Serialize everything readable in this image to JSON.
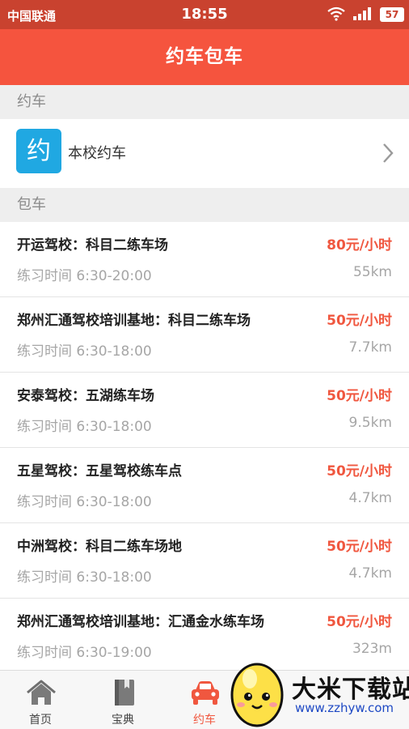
{
  "status_bar": {
    "carrier": "中国联通",
    "time": "18:55",
    "battery": "57"
  },
  "header": {
    "title": "约车包车"
  },
  "section_booking": {
    "title": "约车"
  },
  "school_booking": {
    "icon_char": "约",
    "label": "本校约车"
  },
  "section_charter": {
    "title": "包车"
  },
  "charter_list": [
    {
      "name": "开运驾校：科目二练车场",
      "price": "80元/小时",
      "hours": "练习时间 6:30-20:00",
      "distance": "55km"
    },
    {
      "name": "郑州汇通驾校培训基地：科目二练车场",
      "price": "50元/小时",
      "hours": "练习时间 6:30-18:00",
      "distance": "7.7km"
    },
    {
      "name": "安泰驾校：五湖练车场",
      "price": "50元/小时",
      "hours": "练习时间 6:30-18:00",
      "distance": "9.5km"
    },
    {
      "name": "五星驾校：五星驾校练车点",
      "price": "50元/小时",
      "hours": "练习时间 6:30-18:00",
      "distance": "4.7km"
    },
    {
      "name": "中洲驾校：科目二练车场地",
      "price": "50元/小时",
      "hours": "练习时间 6:30-18:00",
      "distance": "4.7km"
    },
    {
      "name": "郑州汇通驾校培训基地：汇通金水练车场",
      "price": "50元/小时",
      "hours": "练习时间 6:30-19:00",
      "distance": "323m"
    }
  ],
  "tab_bar": {
    "tabs": [
      {
        "label": "首页",
        "icon": "home-icon"
      },
      {
        "label": "宝典",
        "icon": "book-icon"
      },
      {
        "label": "约车",
        "icon": "car-icon",
        "active": true
      }
    ]
  },
  "watermark": {
    "text": "大米下载站",
    "url": "www.zzhyw.com"
  },
  "colors": {
    "accent": "#f5543e",
    "status_bar": "#c9422f",
    "price": "#f0573f",
    "school_icon": "#20a8e2"
  }
}
